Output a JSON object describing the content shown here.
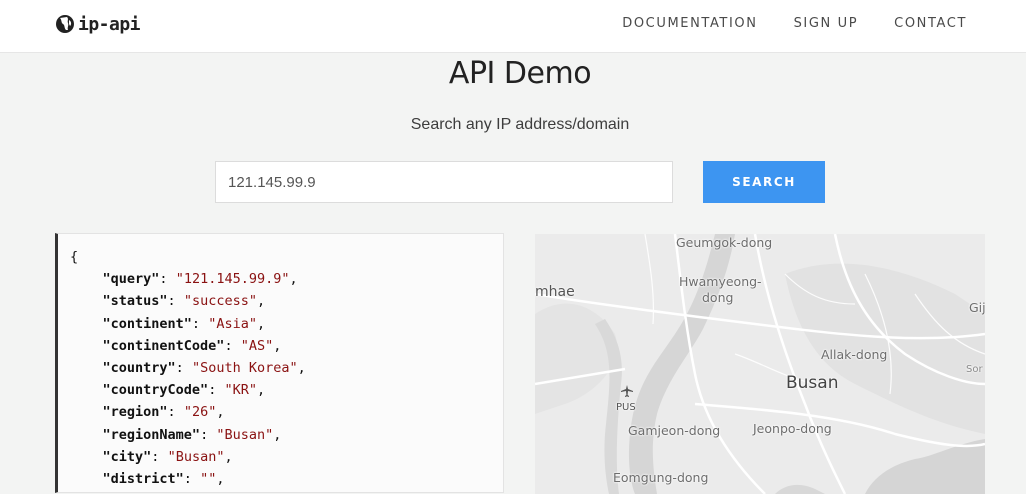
{
  "header": {
    "logo_text": "ip-api",
    "nav": [
      "DOCUMENTATION",
      "SIGN UP",
      "CONTACT"
    ]
  },
  "hero": {
    "title": "API Demo",
    "subtitle": "Search any IP address/domain",
    "search_value": "121.145.99.9",
    "search_button": "SEARCH"
  },
  "json": {
    "open_brace": "{",
    "lines": [
      {
        "key": "\"query\"",
        "value": "\"121.145.99.9\"",
        "comma": ","
      },
      {
        "key": "\"status\"",
        "value": "\"success\"",
        "comma": ","
      },
      {
        "key": "\"continent\"",
        "value": "\"Asia\"",
        "comma": ","
      },
      {
        "key": "\"continentCode\"",
        "value": "\"AS\"",
        "comma": ","
      },
      {
        "key": "\"country\"",
        "value": "\"South Korea\"",
        "comma": ","
      },
      {
        "key": "\"countryCode\"",
        "value": "\"KR\"",
        "comma": ","
      },
      {
        "key": "\"region\"",
        "value": "\"26\"",
        "comma": ","
      },
      {
        "key": "\"regionName\"",
        "value": "\"Busan\"",
        "comma": ","
      },
      {
        "key": "\"city\"",
        "value": "\"Busan\"",
        "comma": ","
      },
      {
        "key": "\"district\"",
        "value": "\"\"",
        "comma": ","
      }
    ]
  },
  "map": {
    "labels": [
      "Geumgok-dong",
      "Hwamyeong-",
      "dong",
      "mhae",
      "Gij",
      "Allak-dong",
      "Busan",
      "Sor",
      "PUS",
      "Gamjeon-dong",
      "Jeonpo-dong",
      "Eomgung-dong"
    ],
    "airport_icon": "airplane-icon"
  }
}
